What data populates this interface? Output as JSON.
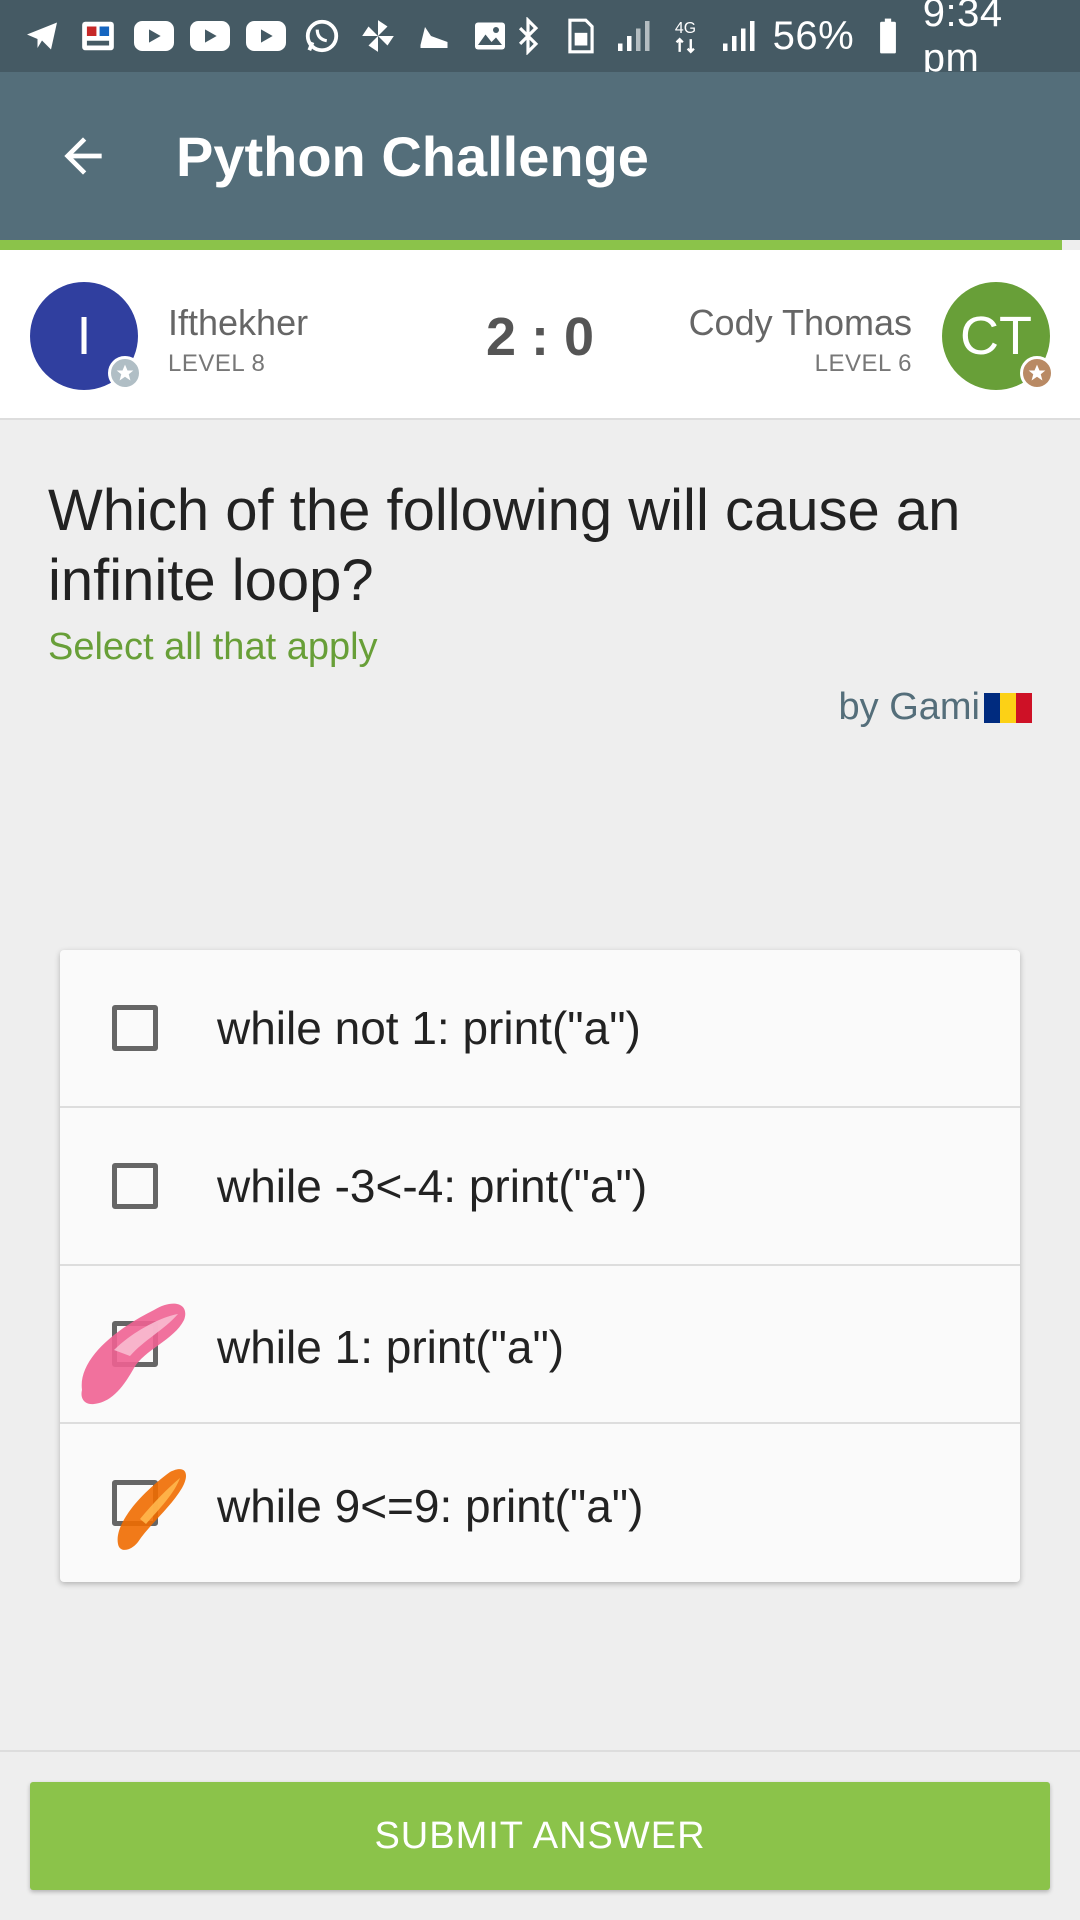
{
  "status_bar": {
    "left_icons": [
      "telegram-icon",
      "app-icon",
      "youtube-icon",
      "youtube-icon",
      "youtube-icon",
      "whatsapp-icon",
      "pinwheel-icon",
      "shoe-icon",
      "image-icon"
    ],
    "right_icons": [
      "bluetooth-icon",
      "sim-icon",
      "signal-icon",
      "4g-icon",
      "signal-icon",
      "battery-icon"
    ],
    "battery": "56%",
    "time": "9:34 pm"
  },
  "app_bar": {
    "title": "Python Challenge",
    "back_icon": "arrow-back-icon"
  },
  "players": {
    "left": {
      "initial": "I",
      "name": "Ifthekher",
      "level": "LEVEL 8",
      "color": "#303f9f"
    },
    "right": {
      "initial": "CT",
      "name": "Cody Thomas",
      "level": "LEVEL 6",
      "color": "#689f38"
    },
    "score": "2 : 0"
  },
  "question": {
    "text": "Which of the following will cause an infinite loop?",
    "hint": "Select all that apply",
    "author": "by Gami"
  },
  "options": [
    {
      "label": "while not 1: print(\"a\")",
      "checked": false
    },
    {
      "label": "while -3<-4: print(\"a\")",
      "checked": false
    },
    {
      "label": "while 1: print(\"a\")",
      "checked": true
    },
    {
      "label": "while 9<=9: print(\"a\")",
      "checked": true
    }
  ],
  "submit_label": "SUBMIT ANSWER",
  "colors": {
    "primary_dark": "#455a64",
    "primary": "#546e7a",
    "accent": "#8bc34a"
  }
}
